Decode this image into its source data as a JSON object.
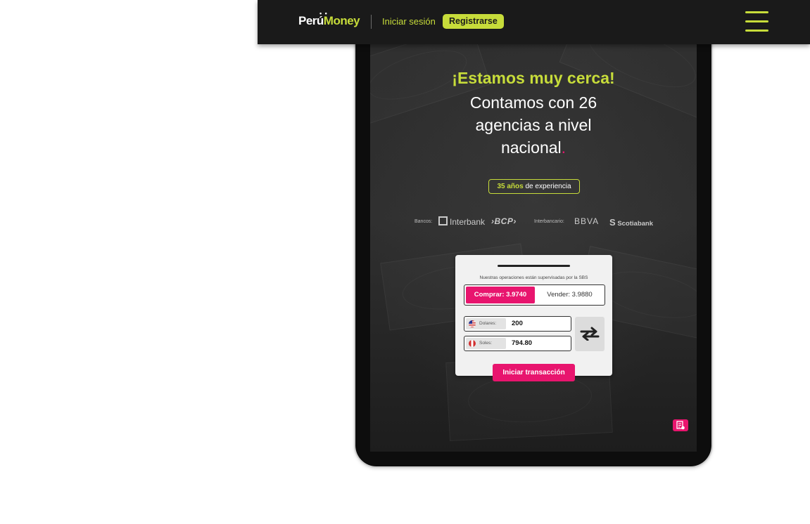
{
  "header": {
    "logo_part1": "Perú",
    "logo_part2": "Money",
    "login_label": "Iniciar sesión",
    "register_label": "Registrarse",
    "menu_icon": "hamburger-menu-icon"
  },
  "hero": {
    "headline": "¡Estamos muy cerca!",
    "subhead": "Contamos con 26 agencias a nivel nacional",
    "subhead_dot": ".",
    "experience_strong": "35 años",
    "experience_rest": " de experiencia"
  },
  "banks": {
    "banks_label": "Bancos:",
    "interbank": "Interbank",
    "bcp": "›BCP›",
    "interbank_label": "Interbancario:",
    "bbva": "BBVA",
    "scotiabank": "Scotiabank"
  },
  "exchange": {
    "note": "Nuestras operaciones están supervisadas por la SBS",
    "buy_label": "Comprar: 3.9740",
    "sell_label": "Vender: 3.9880",
    "usd_label": "Dolares:",
    "usd_value": "200",
    "pen_label": "Soles:",
    "pen_value": "794.80",
    "start_label": "Iniciar transacción"
  },
  "colors": {
    "accent_lime": "#c7dc3a",
    "accent_pink": "#e8156e",
    "header_bg": "#1a1a1a"
  }
}
